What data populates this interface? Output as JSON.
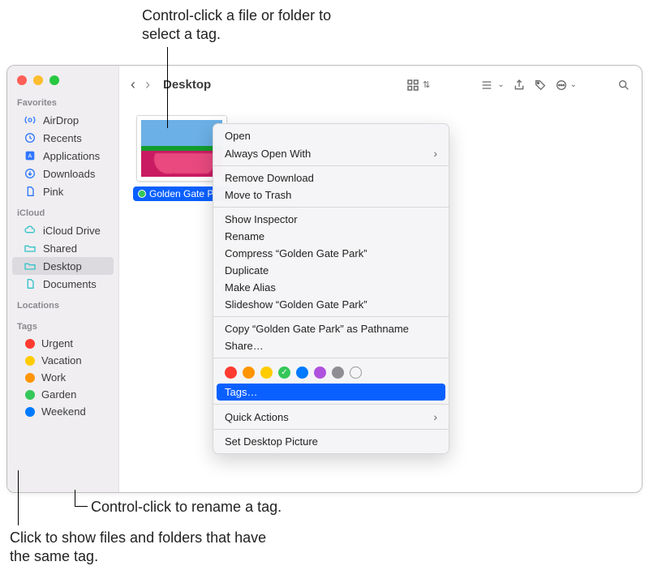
{
  "callouts": {
    "top": "Control-click a file or folder to select a tag.",
    "rename": "Control-click to rename a tag.",
    "showfiles": "Click to show files and folders that have the same tag."
  },
  "window": {
    "title": "Desktop"
  },
  "sidebar": {
    "sections": {
      "favorites": "Favorites",
      "icloud": "iCloud",
      "locations": "Locations",
      "tags": "Tags"
    },
    "favorites": [
      {
        "label": "AirDrop"
      },
      {
        "label": "Recents"
      },
      {
        "label": "Applications"
      },
      {
        "label": "Downloads"
      },
      {
        "label": "Pink"
      }
    ],
    "icloud": [
      {
        "label": "iCloud Drive"
      },
      {
        "label": "Shared"
      },
      {
        "label": "Desktop"
      },
      {
        "label": "Documents"
      }
    ],
    "tags": [
      {
        "label": "Urgent",
        "color": "#ff3b30"
      },
      {
        "label": "Vacation",
        "color": "#ffcc00"
      },
      {
        "label": "Work",
        "color": "#ff9500"
      },
      {
        "label": "Garden",
        "color": "#34c759"
      },
      {
        "label": "Weekend",
        "color": "#007aff"
      }
    ]
  },
  "file": {
    "name": "Golden Gate Park"
  },
  "context_menu": {
    "open": "Open",
    "always_open_with": "Always Open With",
    "remove_download": "Remove Download",
    "move_to_trash": "Move to Trash",
    "show_inspector": "Show Inspector",
    "rename": "Rename",
    "compress": "Compress “Golden Gate Park”",
    "duplicate": "Duplicate",
    "make_alias": "Make Alias",
    "slideshow": "Slideshow “Golden Gate Park”",
    "copy_pathname": "Copy “Golden Gate Park” as Pathname",
    "share": "Share…",
    "tags": "Tags…",
    "quick_actions": "Quick Actions",
    "set_desktop_picture": "Set Desktop Picture",
    "tag_colors": [
      "#ff3b30",
      "#ff9500",
      "#ffcc00",
      "#34c759",
      "#007aff",
      "#af52de",
      "#8e8e93"
    ],
    "tag_selected_index": 3
  }
}
